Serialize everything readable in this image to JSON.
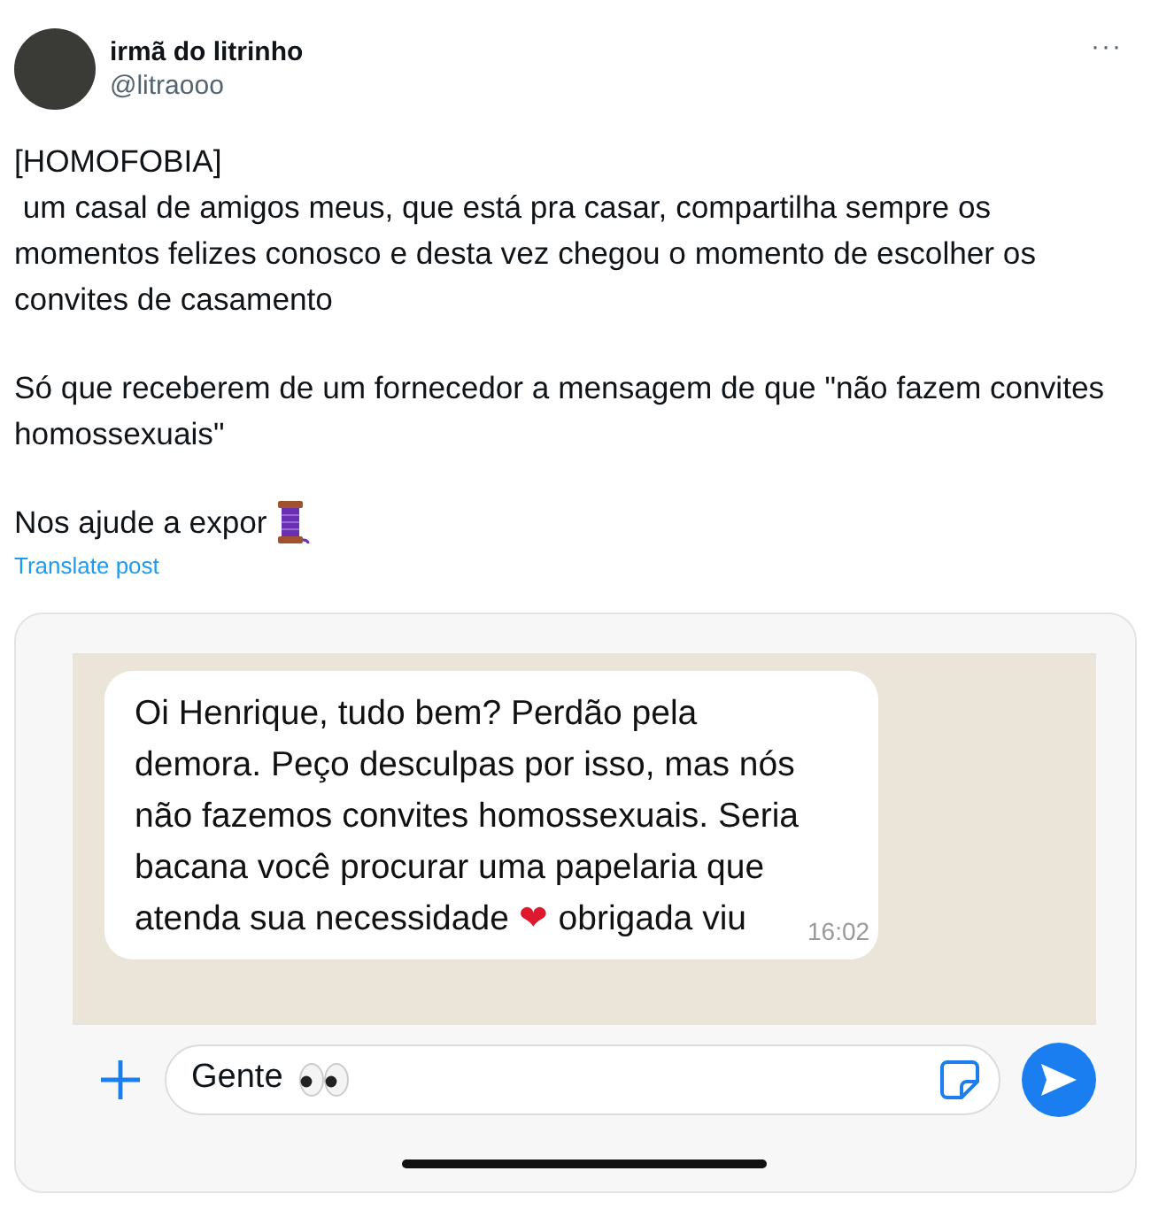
{
  "post": {
    "author_name": "irmã do litrinho",
    "handle": "@litraooo",
    "more": "···",
    "paragraphs": [
      "[HOMOFOBIA]\n um casal de amigos meus, que está pra casar, compartilha sempre os momentos felizes conosco e desta vez chegou o momento de escolher os convites de casamento",
      "Só que receberem de um fornecedor a mensagem de que \"não fazem convites homossexuais\"",
      "Nos ajude a expor"
    ],
    "translate": "Translate post"
  },
  "chat_screenshot": {
    "message": {
      "segments": [
        {
          "kind": "text",
          "text": "Oi Henrique, tudo bem? Perdão pela demora. Peço desculpas por isso, mas nós não fazemos convites homossexuais. Seria bacana você procurar uma papelaria que atenda sua necessidade "
        },
        {
          "kind": "emoji",
          "text": "❤"
        },
        {
          "kind": "text",
          "text": " obrigada viu"
        }
      ],
      "time": "16:02"
    },
    "input": {
      "value": "Gente"
    }
  }
}
